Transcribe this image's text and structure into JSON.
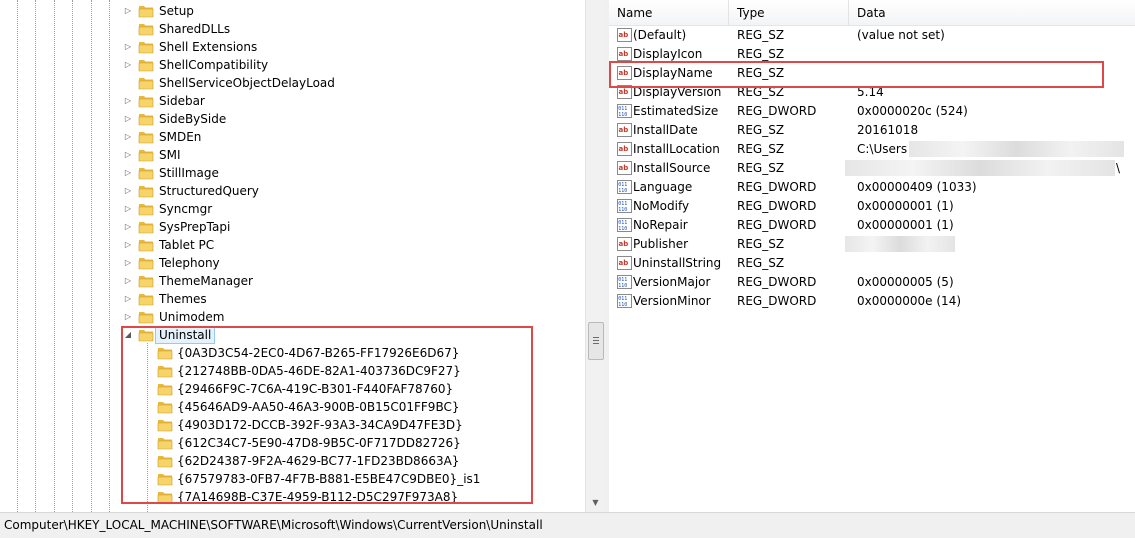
{
  "tree": {
    "items": [
      {
        "label": "Setup",
        "expander": "▷"
      },
      {
        "label": "SharedDLLs",
        "expander": ""
      },
      {
        "label": "Shell Extensions",
        "expander": "▷"
      },
      {
        "label": "ShellCompatibility",
        "expander": "▷"
      },
      {
        "label": "ShellServiceObjectDelayLoad",
        "expander": ""
      },
      {
        "label": "Sidebar",
        "expander": "▷"
      },
      {
        "label": "SideBySide",
        "expander": "▷"
      },
      {
        "label": "SMDEn",
        "expander": "▷"
      },
      {
        "label": "SMI",
        "expander": "▷"
      },
      {
        "label": "StillImage",
        "expander": "▷"
      },
      {
        "label": "StructuredQuery",
        "expander": "▷"
      },
      {
        "label": "Syncmgr",
        "expander": "▷"
      },
      {
        "label": "SysPrepTapi",
        "expander": "▷"
      },
      {
        "label": "Tablet PC",
        "expander": "▷"
      },
      {
        "label": "Telephony",
        "expander": "▷"
      },
      {
        "label": "ThemeManager",
        "expander": "▷"
      },
      {
        "label": "Themes",
        "expander": "▷"
      },
      {
        "label": "Unimodem",
        "expander": "▷"
      },
      {
        "label": "Uninstall",
        "expander": "◢"
      }
    ],
    "subitems": [
      "{0A3D3C54-2EC0-4D67-B265-FF17926E6D67}",
      "{212748BB-0DA5-46DE-82A1-403736DC9F27}",
      "{29466F9C-7C6A-419C-B301-F440FAF78760}",
      "{45646AD9-AA50-46A3-900B-0B15C01FF9BC}",
      "{4903D172-DCCB-392F-93A3-34CA9D47FE3D}",
      "{612C34C7-5E90-47D8-9B5C-0F717DD82726}",
      "{62D24387-9F2A-4629-BC77-1FD23BD8663A}",
      "{67579783-0FB7-4F7B-B881-E5BE47C9DBE0}_is1",
      "{7A14698B-C37E-4959-B112-D5C297F973A8}"
    ]
  },
  "list": {
    "headers": {
      "name": "Name",
      "type": "Type",
      "data": "Data"
    },
    "rows": [
      {
        "name": "(Default)",
        "type": "REG_SZ",
        "data": "(value not set)",
        "icon": "string-value-icon"
      },
      {
        "name": "DisplayIcon",
        "type": "REG_SZ",
        "data": "",
        "icon": "string-value-icon"
      },
      {
        "name": "DisplayName",
        "type": "REG_SZ",
        "data": "",
        "icon": "string-value-icon"
      },
      {
        "name": "DisplayVersion",
        "type": "REG_SZ",
        "data": "5.14",
        "icon": "string-value-icon"
      },
      {
        "name": "EstimatedSize",
        "type": "REG_DWORD",
        "data": "0x0000020c (524)",
        "icon": "binary-value-icon"
      },
      {
        "name": "InstallDate",
        "type": "REG_SZ",
        "data": "20161018",
        "icon": "string-value-icon"
      },
      {
        "name": "InstallLocation",
        "type": "REG_SZ",
        "data": "C:\\Users",
        "icon": "string-value-icon"
      },
      {
        "name": "InstallSource",
        "type": "REG_SZ",
        "data": "\\",
        "icon": "string-value-icon"
      },
      {
        "name": "Language",
        "type": "REG_DWORD",
        "data": "0x00000409 (1033)",
        "icon": "binary-value-icon"
      },
      {
        "name": "NoModify",
        "type": "REG_DWORD",
        "data": "0x00000001 (1)",
        "icon": "binary-value-icon"
      },
      {
        "name": "NoRepair",
        "type": "REG_DWORD",
        "data": "0x00000001 (1)",
        "icon": "binary-value-icon"
      },
      {
        "name": "Publisher",
        "type": "REG_SZ",
        "data": "",
        "icon": "string-value-icon"
      },
      {
        "name": "UninstallString",
        "type": "REG_SZ",
        "data": "",
        "icon": "string-value-icon"
      },
      {
        "name": "VersionMajor",
        "type": "REG_DWORD",
        "data": "0x00000005 (5)",
        "icon": "binary-value-icon"
      },
      {
        "name": "VersionMinor",
        "type": "REG_DWORD",
        "data": "0x0000000e (14)",
        "icon": "binary-value-icon"
      }
    ]
  },
  "status": {
    "path": "Computer\\HKEY_LOCAL_MACHINE\\SOFTWARE\\Microsoft\\Windows\\CurrentVersion\\Uninstall"
  },
  "colors": {
    "highlight": "#e04848",
    "folder": "#f2c94c"
  }
}
